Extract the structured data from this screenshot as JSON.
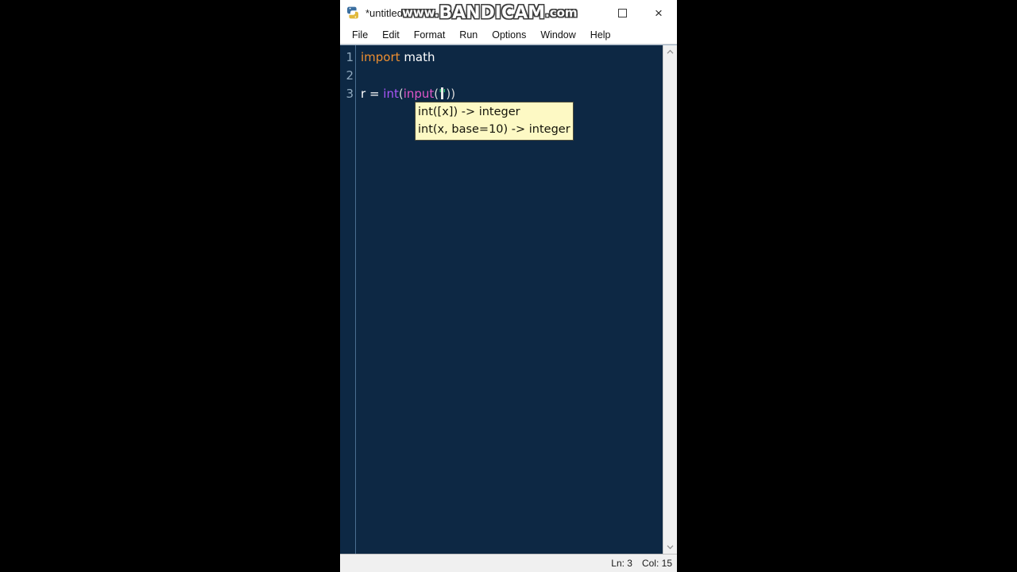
{
  "window": {
    "title": "*untitled",
    "app_icon": "python-idle-icon",
    "controls": {
      "maximize_label": "",
      "close_label": "×"
    }
  },
  "watermark": {
    "prefix": "www.",
    "brand": "BANDICAM",
    "suffix": ".com",
    "full": "www.BANDICAM.com"
  },
  "menu": {
    "items": [
      {
        "label": "File"
      },
      {
        "label": "Edit"
      },
      {
        "label": "Format"
      },
      {
        "label": "Run"
      },
      {
        "label": "Options"
      },
      {
        "label": "Window"
      },
      {
        "label": "Help"
      }
    ]
  },
  "editor": {
    "line_numbers": [
      "1",
      "2",
      "3"
    ],
    "lines": [
      {
        "number": "1",
        "tokens": [
          {
            "text": "import",
            "type": "keyword"
          },
          {
            "text": " ",
            "type": "plain"
          },
          {
            "text": "math",
            "type": "plain"
          }
        ]
      },
      {
        "number": "2",
        "tokens": []
      },
      {
        "number": "3",
        "tokens": [
          {
            "text": "r",
            "type": "plain"
          },
          {
            "text": " = ",
            "type": "plain"
          },
          {
            "text": "int",
            "type": "builtin"
          },
          {
            "text": "(",
            "type": "punct"
          },
          {
            "text": "input",
            "type": "def"
          },
          {
            "text": "(",
            "type": "punct"
          },
          {
            "text": "'",
            "type": "string"
          },
          {
            "text": "CARET",
            "type": "caret"
          },
          {
            "text": "'",
            "type": "string"
          },
          {
            "text": "))",
            "type": "punct"
          }
        ]
      }
    ],
    "colors": {
      "background": "#0d2844",
      "keyword": "#ef8f30",
      "builtin": "#a855f7",
      "definition": "#e056c8",
      "string": "#2ecc71",
      "text": "#ffffff",
      "line_number": "#8fa8bd"
    }
  },
  "calltip": {
    "lines": [
      "int([x]) -> integer",
      "int(x, base=10) -> integer"
    ],
    "background": "#fdf9c4",
    "border": "#4a4a3a"
  },
  "scrollbar": {
    "up_arrow": "⌃",
    "down_arrow": "⌄"
  },
  "statusbar": {
    "line_label": "Ln: 3",
    "col_label": "Col: 15"
  }
}
